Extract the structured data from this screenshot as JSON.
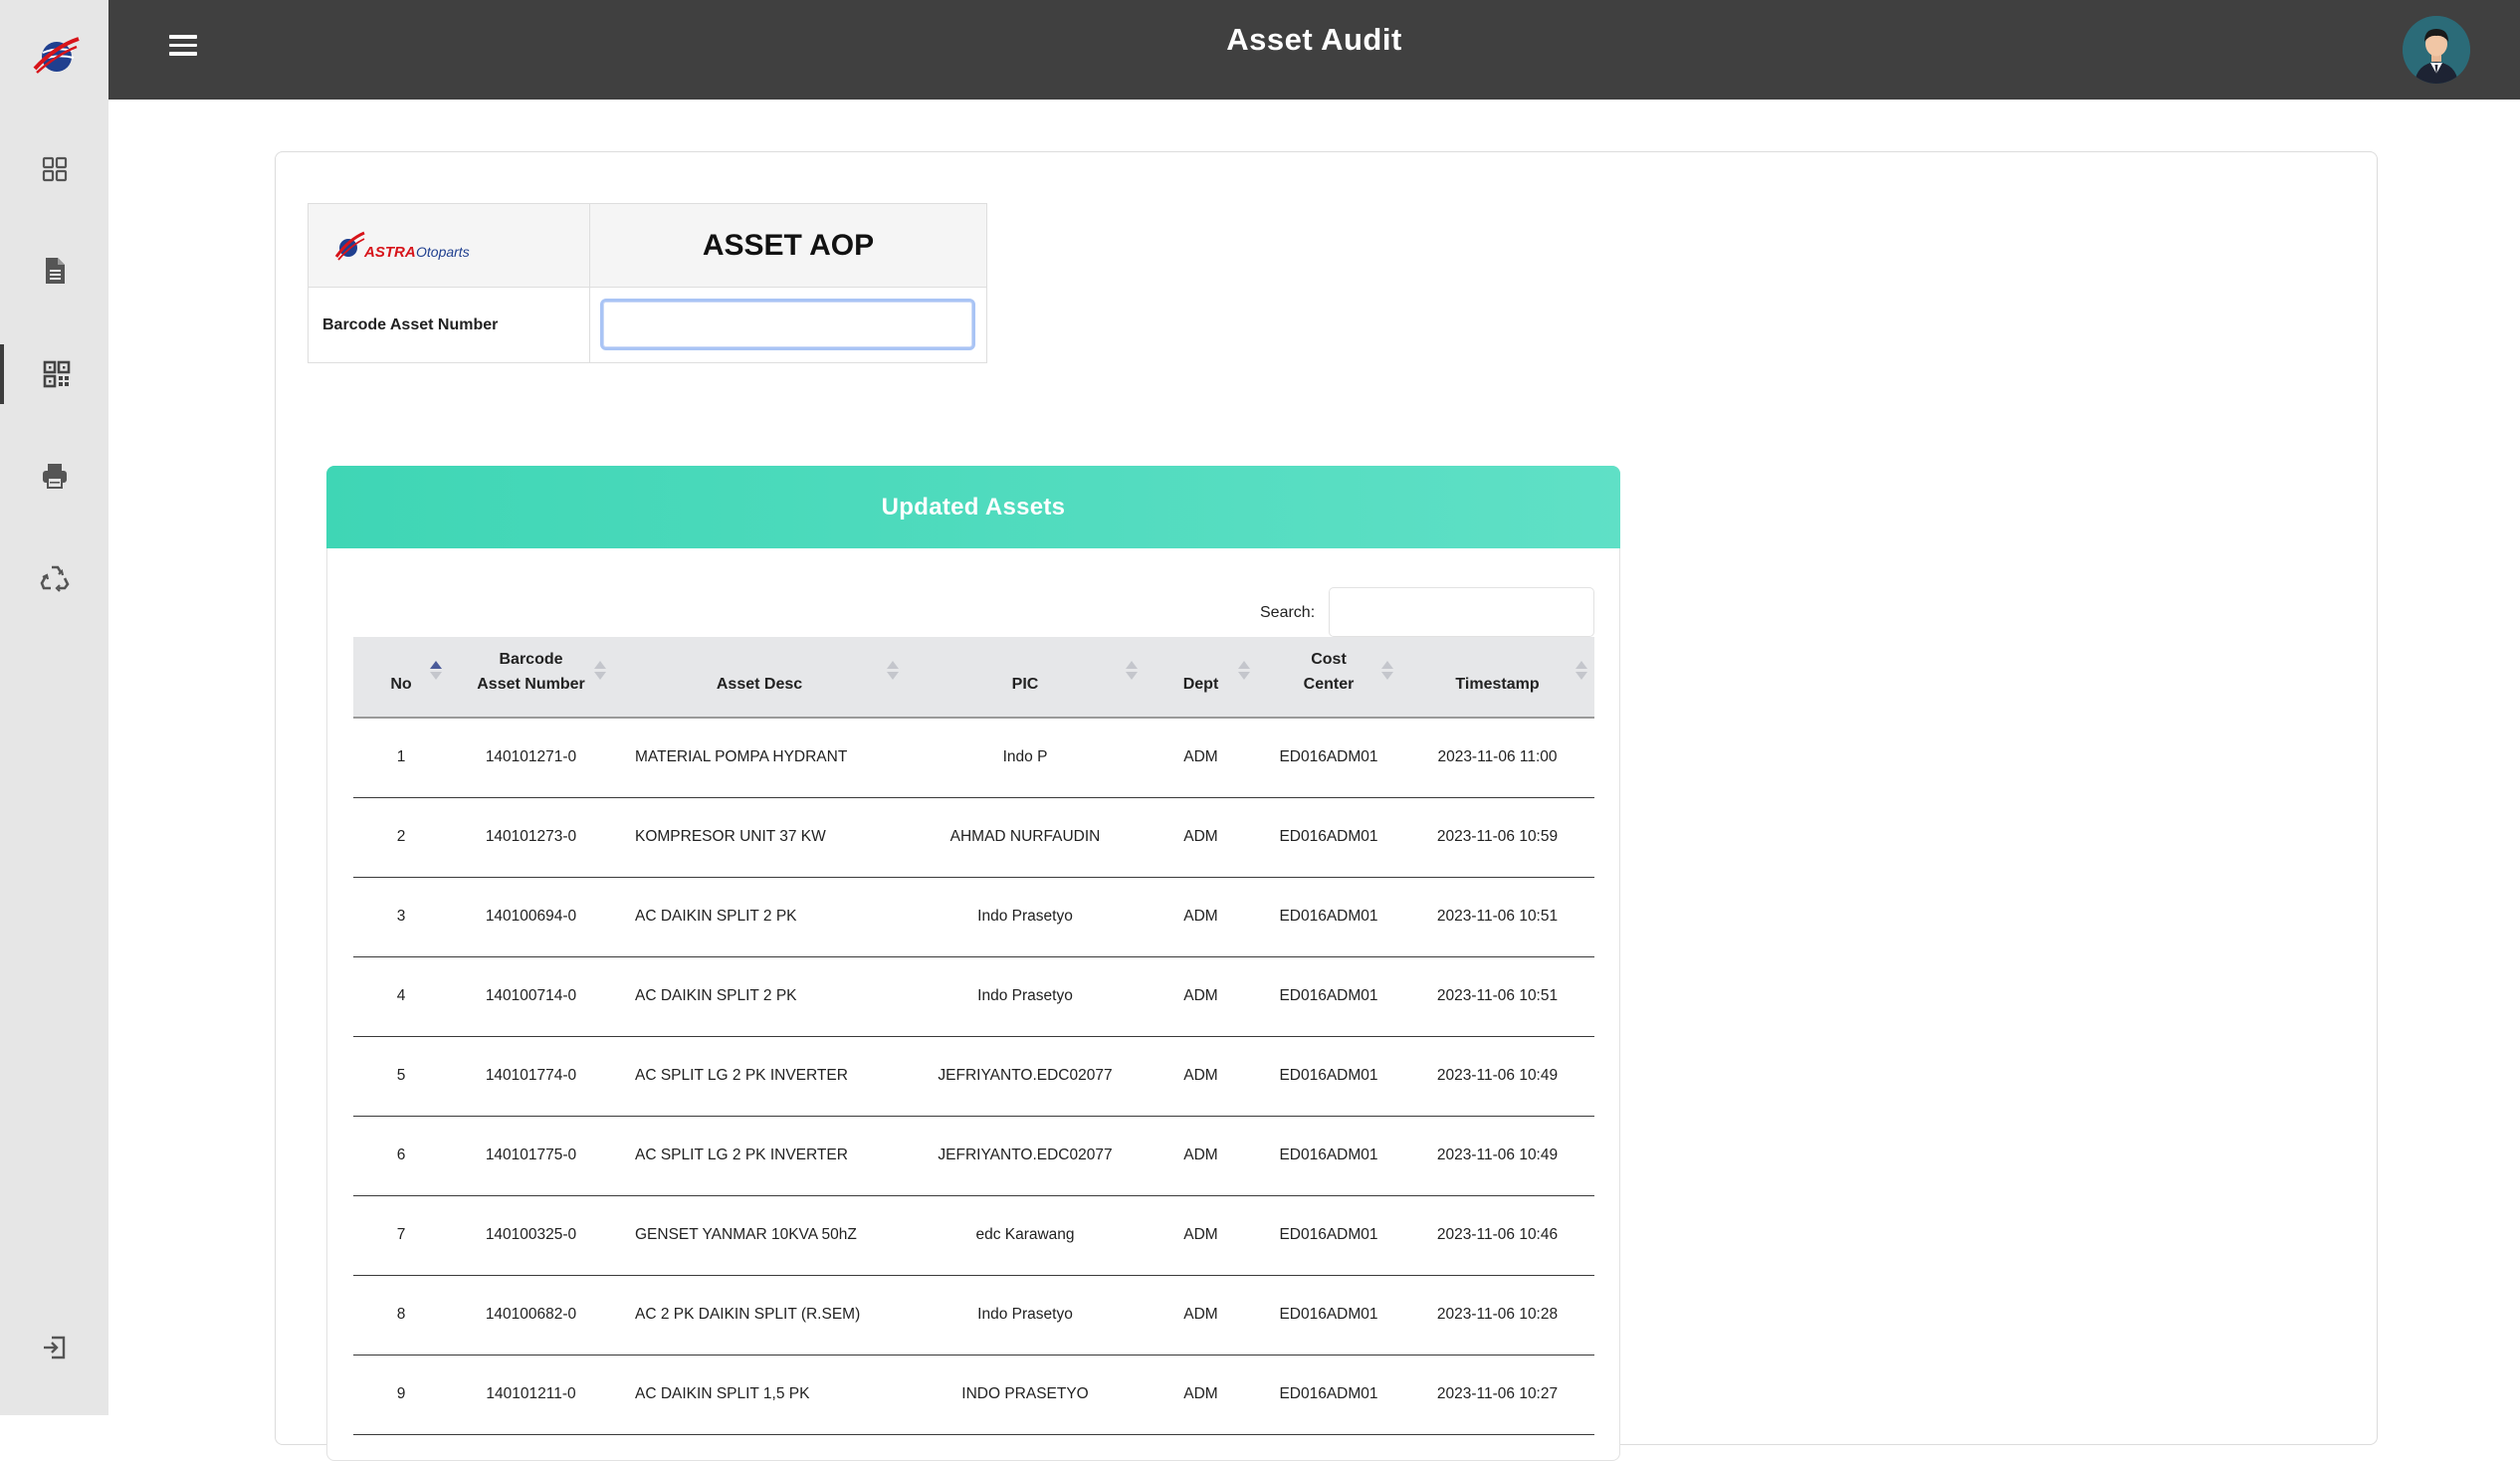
{
  "header": {
    "title": "Asset Audit"
  },
  "sidebar": {
    "items": [
      {
        "name": "dashboard",
        "icon": "grid-icon"
      },
      {
        "name": "document",
        "icon": "document-icon"
      },
      {
        "name": "qr-scan",
        "icon": "qr-code-icon",
        "active": true
      },
      {
        "name": "print",
        "icon": "printer-icon"
      },
      {
        "name": "recycle",
        "icon": "recycle-icon"
      },
      {
        "name": "logout",
        "icon": "logout-icon"
      }
    ]
  },
  "asset_form": {
    "logo_text_brand": "ASTRA",
    "logo_text_sub": "Otoparts",
    "title": "ASSET AOP",
    "barcode_label": "Barcode Asset Number",
    "barcode_value": ""
  },
  "assets_panel": {
    "title": "Updated Assets",
    "search_label": "Search:",
    "search_value": "",
    "columns": [
      {
        "line1": "",
        "line2": "No"
      },
      {
        "line1": "Barcode",
        "line2": "Asset Number"
      },
      {
        "line1": "",
        "line2": "Asset Desc"
      },
      {
        "line1": "",
        "line2": "PIC"
      },
      {
        "line1": "",
        "line2": "Dept"
      },
      {
        "line1": "Cost",
        "line2": "Center"
      },
      {
        "line1": "",
        "line2": "Timestamp"
      }
    ],
    "rows": [
      [
        "1",
        "140101271-0",
        "MATERIAL POMPA HYDRANT",
        "Indo P",
        "ADM",
        "ED016ADM01",
        "2023-11-06 11:00"
      ],
      [
        "2",
        "140101273-0",
        "KOMPRESOR UNIT 37 KW",
        "AHMAD NURFAUDIN",
        "ADM",
        "ED016ADM01",
        "2023-11-06 10:59"
      ],
      [
        "3",
        "140100694-0",
        "AC DAIKIN SPLIT 2 PK",
        "Indo Prasetyo",
        "ADM",
        "ED016ADM01",
        "2023-11-06 10:51"
      ],
      [
        "4",
        "140100714-0",
        "AC DAIKIN SPLIT 2 PK",
        "Indo Prasetyo",
        "ADM",
        "ED016ADM01",
        "2023-11-06 10:51"
      ],
      [
        "5",
        "140101774-0",
        "AC SPLIT LG 2 PK INVERTER",
        "JEFRIYANTO.EDC02077",
        "ADM",
        "ED016ADM01",
        "2023-11-06 10:49"
      ],
      [
        "6",
        "140101775-0",
        "AC SPLIT LG 2 PK INVERTER",
        "JEFRIYANTO.EDC02077",
        "ADM",
        "ED016ADM01",
        "2023-11-06 10:49"
      ],
      [
        "7",
        "140100325-0",
        "GENSET YANMAR 10KVA 50hZ",
        "edc Karawang",
        "ADM",
        "ED016ADM01",
        "2023-11-06 10:46"
      ],
      [
        "8",
        "140100682-0",
        "AC 2 PK DAIKIN SPLIT (R.SEM)",
        "Indo Prasetyo",
        "ADM",
        "ED016ADM01",
        "2023-11-06 10:28"
      ],
      [
        "9",
        "140101211-0",
        "AC DAIKIN SPLIT 1,5 PK",
        "INDO PRASETYO",
        "ADM",
        "ED016ADM01",
        "2023-11-06 10:27"
      ]
    ]
  },
  "colors": {
    "header_bg": "#404040",
    "sidebar_bg": "#e6e6e6",
    "panel_header": "#3fd6b5",
    "table_header_bg": "#e6e7e9",
    "brand_red": "#d7141a",
    "brand_blue": "#1f3f8f"
  }
}
